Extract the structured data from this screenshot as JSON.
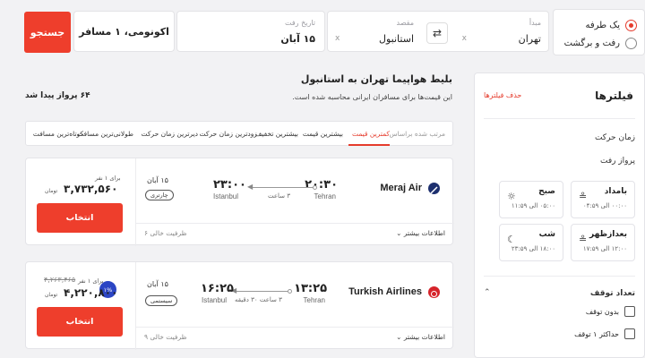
{
  "search": {
    "trip_types": [
      {
        "label": "یک طرفه",
        "checked": true
      },
      {
        "label": "رفت و برگشت",
        "checked": false
      }
    ],
    "origin": {
      "label": "مبدأ",
      "value": "تهران"
    },
    "destination": {
      "label": "مقصد",
      "value": "استانبول"
    },
    "departure": {
      "label": "تاریخ رفت",
      "value": "۱۵ آبان"
    },
    "passengers_value": "اکونومی، ۱ مسافر",
    "search_button": "جستجو",
    "clear_glyph": "x",
    "swap_glyph": "⇄"
  },
  "results": {
    "title": "بلیط هواپیما تهران به استانبول",
    "subtitle": "این قیمت‌ها برای مسافران ایرانی محاسبه شده است.",
    "found_count": "۶۴ پرواز پیدا شد"
  },
  "sort": {
    "label": "مرتب شده براساس",
    "options": [
      "کمترین قیمت",
      "بیشترین قیمت",
      "بیشترین تخفیف",
      "زودترین زمان حرکت",
      "دیرترین زمان حرکت",
      "طولانی‌ترین مسافت",
      "کوتاه‌ترین مسافت"
    ]
  },
  "flights": [
    {
      "airline": "Meraj Air",
      "depart_time": "۲۰:۳۰",
      "depart_city": "Tehran",
      "arrive_time": "۲۳:۰۰",
      "arrive_city": "Istanbul",
      "duration": "۳ ساعت",
      "date": "۱۵ آبان",
      "flight_class": "چارتری",
      "per_adult": "برای ۱ نفر",
      "price": "۳,۷۳۲,۵۶۰",
      "old_price": "",
      "currency": "تومان",
      "select_label": "انتخاب",
      "more_info": "اطلاعات بیشتر",
      "seats_left": "ظرفیت خالی ۶",
      "discount": ""
    },
    {
      "airline": "Turkish Airlines",
      "depart_time": "۱۳:۲۵",
      "depart_city": "Tehran",
      "arrive_time": "۱۶:۲۵",
      "arrive_city": "Istanbul",
      "duration": "۳ ساعت ۳۰ دقیقه",
      "date": "۱۵ آبان",
      "flight_class": "سیستمی",
      "per_adult": "برای ۱ نفر",
      "price": "۴,۲۲۰,۸۰۰",
      "old_price": "۴,۲۶۳,۴۶۵",
      "currency": "تومان",
      "select_label": "انتخاب",
      "more_info": "اطلاعات بیشتر",
      "seats_left": "ظرفیت خالی ۹",
      "discount": "۱%"
    }
  ],
  "filters": {
    "title": "فیلترها",
    "clear_label": "حذف فیلترها",
    "departure_time": {
      "title": "زمان حرکت",
      "subtitle": "پرواز رفت",
      "slots": [
        {
          "name": "بامداد",
          "range": "۰۰:۰۰ الی ۰۴:۵۹",
          "icon": "sunrise-icon"
        },
        {
          "name": "صبح",
          "range": "۰۵:۰۰ الی ۱۱:۵۹",
          "icon": "sun-icon"
        },
        {
          "name": "بعدازظهر",
          "range": "۱۲:۰۰ الی ۱۷:۵۹",
          "icon": "sunset-icon"
        },
        {
          "name": "شب",
          "range": "۱۸:۰۰ الی ۲۳:۵۹",
          "icon": "moon-icon"
        }
      ]
    },
    "stops": {
      "title": "تعداد توقف",
      "options": [
        "بدون توقف",
        "حداکثر ۱ توقف"
      ]
    }
  },
  "colors": {
    "accent": "#ee3e2c",
    "badge": "#2b45c4",
    "background": "#f2f2f4"
  }
}
